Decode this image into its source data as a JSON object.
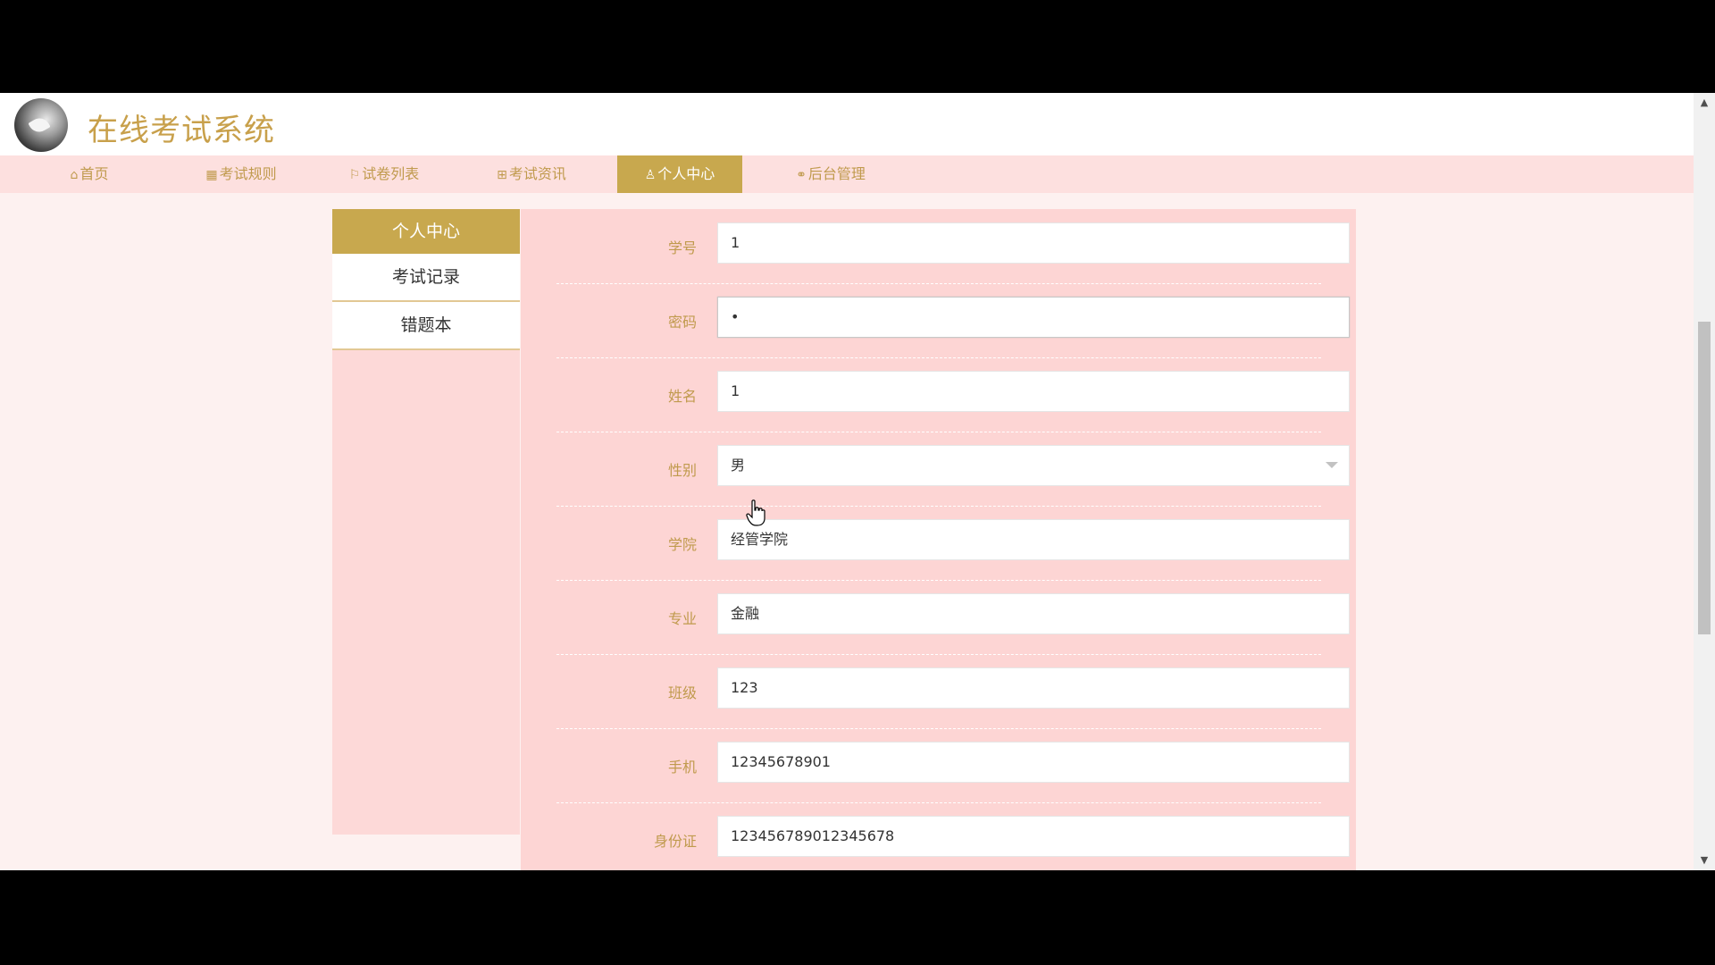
{
  "header": {
    "site_title": "在线考试系统"
  },
  "nav": {
    "items": [
      {
        "label": "首页",
        "icon": "home-icon"
      },
      {
        "label": "考试规则",
        "icon": "grid-icon"
      },
      {
        "label": "试卷列表",
        "icon": "flag-icon"
      },
      {
        "label": "考试资讯",
        "icon": "apps-icon"
      },
      {
        "label": "个人中心",
        "icon": "user-icon",
        "active": true
      },
      {
        "label": "后台管理",
        "icon": "link-icon"
      }
    ]
  },
  "sidebar": {
    "title": "个人中心",
    "items": [
      {
        "label": "考试记录"
      },
      {
        "label": "错题本"
      }
    ]
  },
  "form": {
    "fields": [
      {
        "label": "学号",
        "value": "1"
      },
      {
        "label": "密码",
        "value": "•"
      },
      {
        "label": "姓名",
        "value": "1"
      },
      {
        "label": "性别",
        "value": "男"
      },
      {
        "label": "学院",
        "value": "经管学院"
      },
      {
        "label": "专业",
        "value": "金融"
      },
      {
        "label": "班级",
        "value": "123"
      },
      {
        "label": "手机",
        "value": "12345678901"
      },
      {
        "label": "身份证",
        "value": "123456789012345678"
      }
    ]
  },
  "colors": {
    "accent": "#c8a84e",
    "nav_bg": "#fde0df",
    "panel_bg": "#fdd5d4",
    "label_text": "#c09a4d"
  }
}
